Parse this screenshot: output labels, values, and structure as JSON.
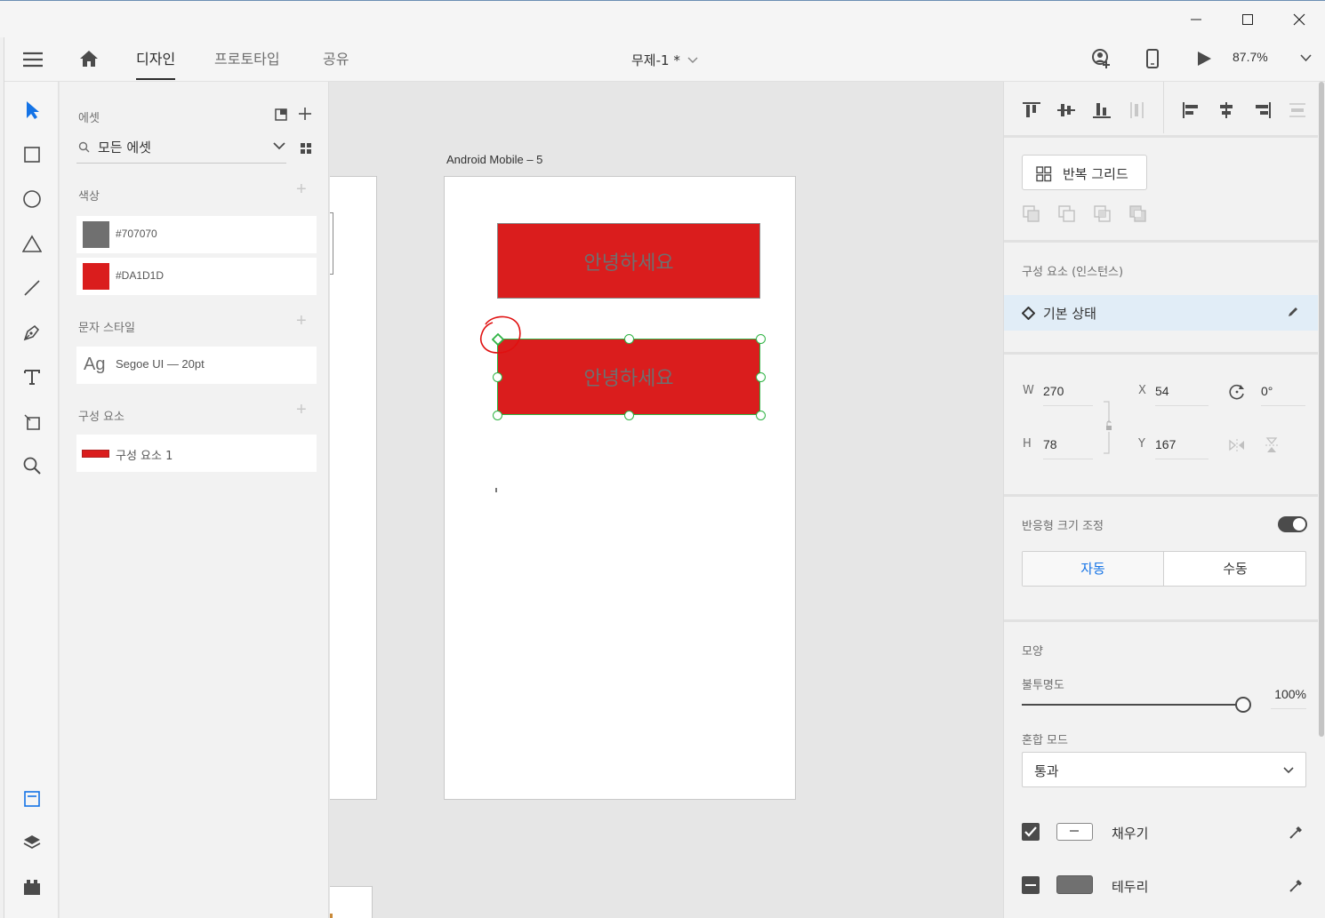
{
  "window": {
    "minimize_icon": "minimize-icon",
    "maximize_icon": "maximize-icon",
    "close_icon": "close-icon"
  },
  "header": {
    "menu_icon": "hamburger-icon",
    "home_icon": "home-icon",
    "tabs": [
      {
        "label": "디자인",
        "active": true
      },
      {
        "label": "프로토타입",
        "active": false
      },
      {
        "label": "공유",
        "active": false
      }
    ],
    "doc_title": "무제-1 *",
    "zoom": "87.7%"
  },
  "assets": {
    "title": "에셋",
    "search_value": "모든 에셋",
    "colors_label": "색상",
    "colors": [
      {
        "hex": "#707070",
        "label": "#707070"
      },
      {
        "hex": "#DA1D1D",
        "label": "#DA1D1D"
      }
    ],
    "char_styles_label": "문자 스타일",
    "char_style": {
      "sample": "Ag",
      "label": "Segoe UI — 20pt"
    },
    "components_label": "구성 요소",
    "component": {
      "label": "구성 요소 1"
    }
  },
  "canvas": {
    "artboard_label": "Android Mobile – 5",
    "button1_text": "안녕하세요",
    "button2_text": "안녕하세요",
    "accent_red": "#DA1D1D",
    "selection_color": "#2FB344"
  },
  "props": {
    "repeat_grid_label": "반복 그리드",
    "component_section_label": "구성 요소 (인스턴스)",
    "state_label": "기본 상태",
    "w_label": "W",
    "w_value": "270",
    "x_label": "X",
    "x_value": "54",
    "h_label": "H",
    "h_value": "78",
    "y_label": "Y",
    "y_value": "167",
    "rotation_value": "0°",
    "responsive_label": "반응형 크기 조정",
    "responsive_on": true,
    "auto_label": "자동",
    "manual_label": "수동",
    "appearance_label": "모양",
    "opacity_label": "불투명도",
    "opacity_value": "100%",
    "opacity_fraction": 1.0,
    "blend_label": "혼합 모드",
    "blend_value": "통과",
    "fill_label": "채우기",
    "fill_checked": true,
    "border_label": "테두리",
    "border_checked": false
  }
}
